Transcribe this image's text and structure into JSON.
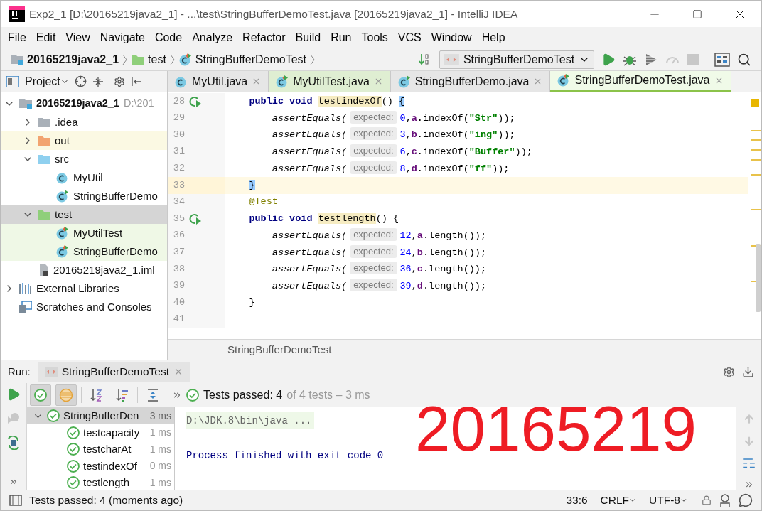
{
  "window": {
    "title": "Exp2_1 [D:\\20165219java2_1] - ...\\test\\StringBufferDemoTest.java [20165219java2_1] - IntelliJ IDEA"
  },
  "menu": [
    "File",
    "Edit",
    "View",
    "Navigate",
    "Code",
    "Analyze",
    "Refactor",
    "Build",
    "Run",
    "Tools",
    "VCS",
    "Window",
    "Help"
  ],
  "breadcrumbs": [
    {
      "label": "20165219java2_1",
      "kind": "module"
    },
    {
      "label": "test",
      "kind": "test-folder"
    },
    {
      "label": "StringBufferDemoTest",
      "kind": "test-class"
    }
  ],
  "run_config": {
    "label": "StringBufferDemoTest"
  },
  "project": {
    "title": "Project",
    "tree": [
      {
        "label": "20165219java2_1",
        "path": "D:\\201",
        "kind": "module",
        "expanded": true,
        "selected": false,
        "children": [
          {
            "label": ".idea",
            "kind": "folder",
            "expanded": false,
            "selected": false
          },
          {
            "label": "out",
            "kind": "excluded-folder",
            "expanded": false,
            "selected": false
          },
          {
            "label": "src",
            "kind": "source-folder",
            "expanded": true,
            "selected": false,
            "children": [
              {
                "label": "MyUtil",
                "kind": "class",
                "selected": false
              },
              {
                "label": "StringBufferDemo",
                "kind": "main-class",
                "selected": false
              }
            ]
          },
          {
            "label": "test",
            "kind": "test-folder",
            "expanded": true,
            "selected": true,
            "children": [
              {
                "label": "MyUtilTest",
                "kind": "test-class",
                "selected": false
              },
              {
                "label": "StringBufferDemo",
                "kind": "test-class",
                "selected": false
              }
            ]
          },
          {
            "label": "20165219java2_1.iml",
            "kind": "module-file",
            "selected": false
          }
        ]
      },
      {
        "label": "External Libraries",
        "kind": "libraries",
        "expanded": false,
        "selected": false
      },
      {
        "label": "Scratches and Consoles",
        "kind": "scratches",
        "selected": false
      }
    ]
  },
  "tabs": [
    {
      "label": "MyUtil.java",
      "kind": "class",
      "selected": false
    },
    {
      "label": "MyUtilTest.java",
      "kind": "test-class",
      "selected": false
    },
    {
      "label": "StringBufferDemo.java",
      "kind": "main-class",
      "selected": false
    },
    {
      "label": "StringBufferDemoTest.java",
      "kind": "test-class",
      "selected": true
    }
  ],
  "code": {
    "lines": [
      {
        "number": "28",
        "run_gutter": true,
        "current": false,
        "segments": [
          {
            "kind": "keyword",
            "text": "    public void "
          },
          {
            "kind": "method",
            "text": "testindexOf"
          },
          {
            "kind": "plain",
            "text": "() "
          },
          {
            "kind": "brace_match",
            "text": "{"
          }
        ]
      },
      {
        "number": "29",
        "run_gutter": false,
        "current": false,
        "segments": [
          {
            "kind": "call",
            "text": "        assertEquals("
          },
          {
            "kind": "hint",
            "text": "expected:"
          },
          {
            "kind": "number",
            "text": "0"
          },
          {
            "kind": "plain",
            "text": ","
          },
          {
            "kind": "field",
            "text": "a"
          },
          {
            "kind": "plain",
            "text": ".indexOf("
          },
          {
            "kind": "string",
            "text": "\"Str\""
          },
          {
            "kind": "plain",
            "text": "));"
          }
        ]
      },
      {
        "number": "30",
        "run_gutter": false,
        "current": false,
        "segments": [
          {
            "kind": "call",
            "text": "        assertEquals("
          },
          {
            "kind": "hint",
            "text": "expected:"
          },
          {
            "kind": "number",
            "text": "3"
          },
          {
            "kind": "plain",
            "text": ","
          },
          {
            "kind": "field",
            "text": "b"
          },
          {
            "kind": "plain",
            "text": ".indexOf("
          },
          {
            "kind": "string",
            "text": "\"ing\""
          },
          {
            "kind": "plain",
            "text": "));"
          }
        ]
      },
      {
        "number": "31",
        "run_gutter": false,
        "current": false,
        "segments": [
          {
            "kind": "call",
            "text": "        assertEquals("
          },
          {
            "kind": "hint",
            "text": "expected:"
          },
          {
            "kind": "number",
            "text": "6"
          },
          {
            "kind": "plain",
            "text": ","
          },
          {
            "kind": "field",
            "text": "c"
          },
          {
            "kind": "plain",
            "text": ".indexOf("
          },
          {
            "kind": "string",
            "text": "\"Buffer\""
          },
          {
            "kind": "plain",
            "text": "));"
          }
        ]
      },
      {
        "number": "32",
        "run_gutter": false,
        "current": false,
        "segments": [
          {
            "kind": "call",
            "text": "        assertEquals("
          },
          {
            "kind": "hint",
            "text": "expected:"
          },
          {
            "kind": "number",
            "text": "8"
          },
          {
            "kind": "plain",
            "text": ","
          },
          {
            "kind": "field",
            "text": "d"
          },
          {
            "kind": "plain",
            "text": ".indexOf("
          },
          {
            "kind": "string",
            "text": "\"ff\""
          },
          {
            "kind": "plain",
            "text": "));"
          }
        ]
      },
      {
        "number": "33",
        "run_gutter": false,
        "current": true,
        "segments": [
          {
            "kind": "brace_match",
            "text": "    }"
          }
        ]
      },
      {
        "number": "34",
        "run_gutter": false,
        "current": false,
        "segments": [
          {
            "kind": "annotation",
            "text": "    @Test"
          }
        ]
      },
      {
        "number": "35",
        "run_gutter": true,
        "current": false,
        "segments": [
          {
            "kind": "keyword",
            "text": "    public void "
          },
          {
            "kind": "method",
            "text": "testlength"
          },
          {
            "kind": "plain",
            "text": "() {"
          }
        ]
      },
      {
        "number": "36",
        "run_gutter": false,
        "current": false,
        "segments": [
          {
            "kind": "call",
            "text": "        assertEquals("
          },
          {
            "kind": "hint",
            "text": "expected:"
          },
          {
            "kind": "number",
            "text": "12"
          },
          {
            "kind": "plain",
            "text": ","
          },
          {
            "kind": "field",
            "text": "a"
          },
          {
            "kind": "plain",
            "text": ".length());"
          }
        ]
      },
      {
        "number": "37",
        "run_gutter": false,
        "current": false,
        "segments": [
          {
            "kind": "call",
            "text": "        assertEquals("
          },
          {
            "kind": "hint",
            "text": "expected:"
          },
          {
            "kind": "number",
            "text": "24"
          },
          {
            "kind": "plain",
            "text": ","
          },
          {
            "kind": "field",
            "text": "b"
          },
          {
            "kind": "plain",
            "text": ".length());"
          }
        ]
      },
      {
        "number": "38",
        "run_gutter": false,
        "current": false,
        "segments": [
          {
            "kind": "call",
            "text": "        assertEquals("
          },
          {
            "kind": "hint",
            "text": "expected:"
          },
          {
            "kind": "number",
            "text": "36"
          },
          {
            "kind": "plain",
            "text": ","
          },
          {
            "kind": "field",
            "text": "c"
          },
          {
            "kind": "plain",
            "text": ".length());"
          }
        ]
      },
      {
        "number": "39",
        "run_gutter": false,
        "current": false,
        "segments": [
          {
            "kind": "call",
            "text": "        assertEquals("
          },
          {
            "kind": "hint",
            "text": "expected:"
          },
          {
            "kind": "number",
            "text": "39"
          },
          {
            "kind": "plain",
            "text": ","
          },
          {
            "kind": "field",
            "text": "d"
          },
          {
            "kind": "plain",
            "text": ".length());"
          }
        ]
      },
      {
        "number": "40",
        "run_gutter": false,
        "current": false,
        "segments": [
          {
            "kind": "plain",
            "text": "    }"
          }
        ]
      },
      {
        "number": "41",
        "run_gutter": false,
        "current": false
      }
    ],
    "breadcrumb": "StringBufferDemoTest"
  },
  "run": {
    "label": "Run:",
    "tab": "StringBufferDemoTest",
    "toolbar": [
      {
        "kind": "show-passed",
        "pressed": true
      },
      {
        "kind": "show-ignored",
        "pressed": true
      },
      {
        "kind": "sort-alpha",
        "pressed": false
      },
      {
        "kind": "sort-duration",
        "pressed": false
      },
      {
        "kind": "expand-all",
        "pressed": false
      }
    ],
    "summary": "Tests passed: 4",
    "summary_detail": "of 4 tests – 3 ms",
    "tree": [
      {
        "label": "StringBufferDen",
        "time": "3 ms",
        "expanded": true,
        "selected": true,
        "children": [
          {
            "label": "testcapacity",
            "time": "1 ms",
            "selected": false
          },
          {
            "label": "testcharAt",
            "time": "1 ms",
            "selected": false
          },
          {
            "label": "testindexOf",
            "time": "0 ms",
            "selected": false
          },
          {
            "label": "testlength",
            "time": "1 ms",
            "selected": false
          }
        ]
      }
    ],
    "console": [
      {
        "kind": "command",
        "text": "D:\\JDK.8\\bin\\java ..."
      },
      {
        "kind": "output",
        "text": "Process finished with exit code 0"
      }
    ],
    "annotation": "20165219"
  },
  "status_bar": {
    "message": "Tests passed: 4 (moments ago)",
    "position": "33:6",
    "line_separator": "CRLF",
    "encoding": "UTF-8"
  }
}
